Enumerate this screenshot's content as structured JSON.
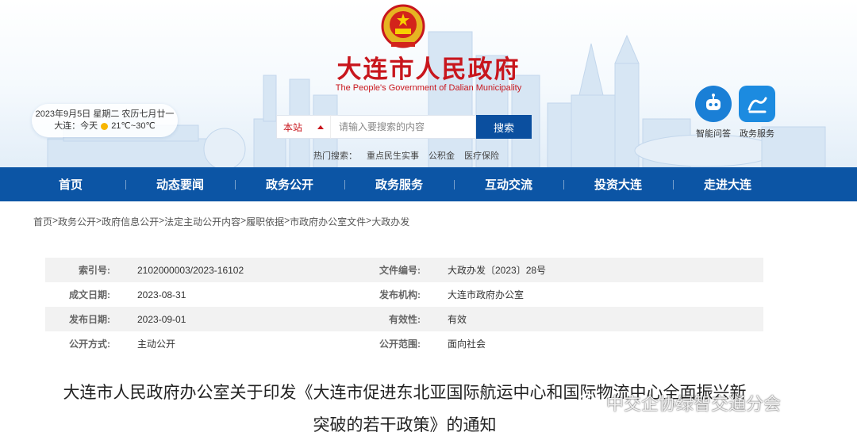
{
  "header": {
    "site_title": "大连市人民政府",
    "site_subtitle": "The People's Government of Dalian Municipality",
    "date_line": "2023年9月5日 星期二 农历七月廿一",
    "weather_city": "大连：今天",
    "weather_temp": "21℃~30℃",
    "colors": {
      "brand_red": "#c8161d",
      "nav_blue": "#0c55a5"
    }
  },
  "search": {
    "scope_label": "本站",
    "placeholder": "请输入要搜索的内容",
    "button_label": "搜索",
    "hot_label": "热门搜索：",
    "hot_terms": [
      "重点民生实事",
      "公积金",
      "医疗保险"
    ]
  },
  "quick_links": [
    {
      "label": "智能问答",
      "icon": "robot-icon"
    },
    {
      "label": "政务服务",
      "icon": "gov-service-icon"
    }
  ],
  "nav": {
    "items": [
      "首页",
      "动态要闻",
      "政务公开",
      "政务服务",
      "互动交流",
      "投资大连",
      "走进大连"
    ]
  },
  "breadcrumb": [
    "首页",
    "政务公开",
    "政府信息公开",
    "法定主动公开内容",
    "履职依据",
    "市政府办公室文件",
    "大政办发"
  ],
  "info": {
    "rows": [
      {
        "label1": "索引号:",
        "value1": "2102000003/2023-16102",
        "label2": "文件编号:",
        "value2": "大政办发〔2023〕28号"
      },
      {
        "label1": "成文日期:",
        "value1": "2023-08-31",
        "label2": "发布机构:",
        "value2": "大连市政府办公室"
      },
      {
        "label1": "发布日期:",
        "value1": "2023-09-01",
        "label2": "有效性:",
        "value2": "有效"
      },
      {
        "label1": "公开方式:",
        "value1": "主动公开",
        "label2": "公开范围:",
        "value2": "面向社会"
      }
    ]
  },
  "document": {
    "title_line1": "大连市人民政府办公室关于印发《大连市促进东北亚国际航运中心和国际物流中心全面振兴新",
    "title_line2": "突破的若干政策》的通知"
  },
  "watermark": {
    "text": "中交企协绿智交通分会"
  }
}
